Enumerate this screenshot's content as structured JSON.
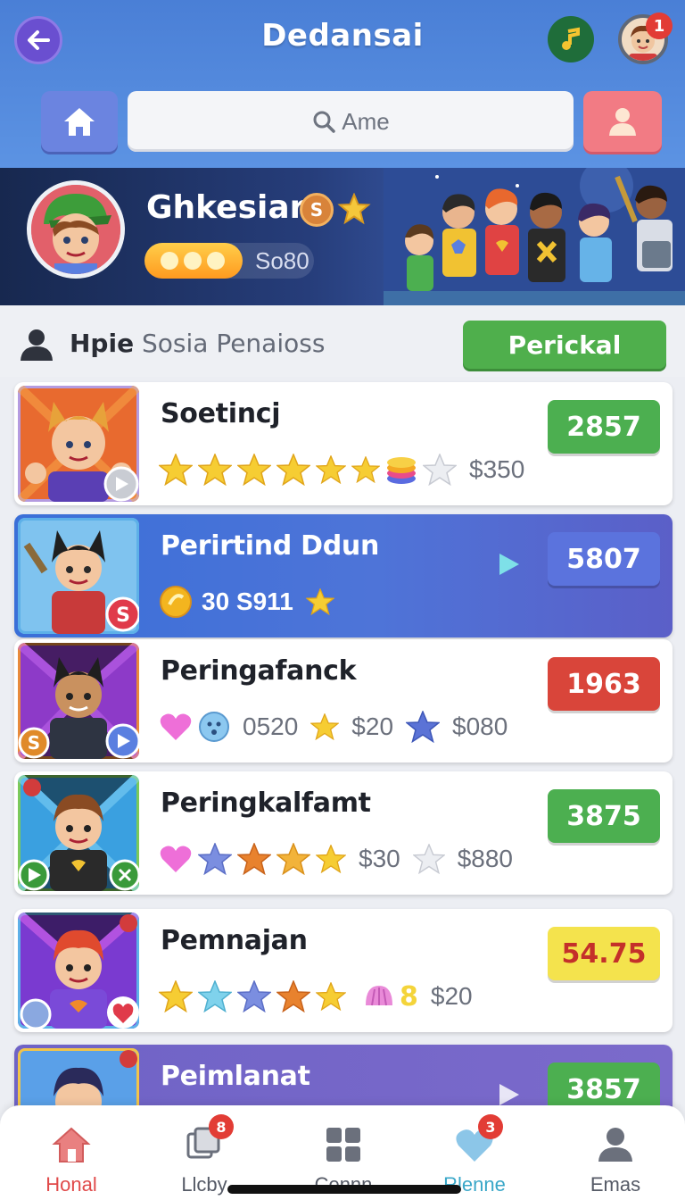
{
  "header": {
    "title": "Dedansai",
    "notification_count": "1",
    "search_placeholder": "Ame"
  },
  "banner": {
    "player_name": "Ghkesiar",
    "coin_badge": "S",
    "coins": "So80",
    "progress": 0.58
  },
  "section": {
    "title_bold": "Hpie",
    "title_rest": "Sosia Penaioss",
    "button_label": "Perickal"
  },
  "items": [
    {
      "title": "Soetincj",
      "price": "$350",
      "score": "2857",
      "score_color": "#4caf50"
    },
    {
      "title": "Perirtind Ddun",
      "meta": "30 S911",
      "score": "5807",
      "score_color": "#5b73dd"
    },
    {
      "title": "Peringafanck",
      "meta_a": "0520",
      "meta_b": "$20",
      "meta_c": "$080",
      "coin_badge": "S",
      "score": "1963",
      "score_color": "#d9453a"
    },
    {
      "title": "Peringkalfamt",
      "meta_a": "$30",
      "meta_b": "$880",
      "score": "3875",
      "score_color": "#4caf50"
    },
    {
      "title": "Pemnajan",
      "meta_badge": "8",
      "price": "$20",
      "score": "54.75",
      "score_color": "#f4e34d"
    },
    {
      "title": "Peimlanat",
      "score": "3857",
      "score_color": "#4caf50"
    }
  ],
  "nav": {
    "items": [
      {
        "label": "Honal",
        "icon": "home-icon"
      },
      {
        "label": "Llcby",
        "icon": "copy-icon",
        "badge": "8"
      },
      {
        "label": "Cennn",
        "icon": "grid-icon"
      },
      {
        "label": "Rlenne",
        "icon": "heart-icon",
        "badge": "3"
      },
      {
        "label": "Emas",
        "icon": "person-icon"
      }
    ]
  }
}
